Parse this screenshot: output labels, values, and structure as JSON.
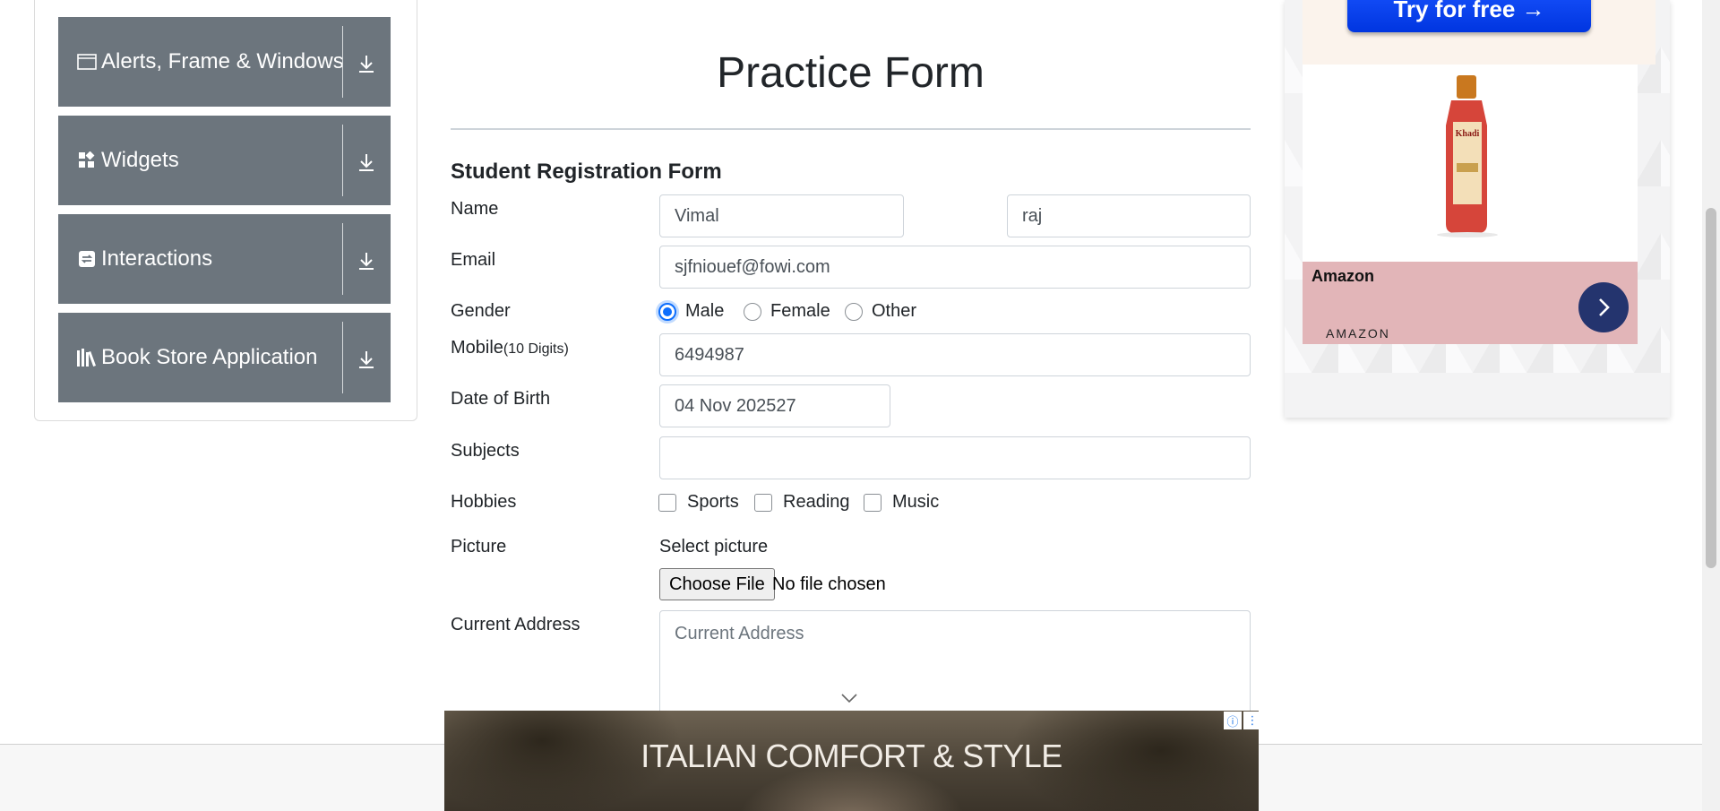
{
  "sidebar": {
    "groups": [
      {
        "label": "Alerts, Frame & Windows",
        "icon": "window-icon"
      },
      {
        "label": "Widgets",
        "icon": "widgets-icon"
      },
      {
        "label": "Interactions",
        "icon": "interactions-icon"
      },
      {
        "label": "Book Store Application",
        "icon": "books-icon"
      }
    ]
  },
  "form": {
    "title": "Practice Form",
    "heading": "Student Registration Form",
    "name_label": "Name",
    "first_name": "Vimal",
    "last_name": "raj",
    "email_label": "Email",
    "email": "sjfniouef@fowi.com",
    "gender_label": "Gender",
    "gender_options": [
      "Male",
      "Female",
      "Other"
    ],
    "gender_selected": "Male",
    "mobile_label": "Mobile",
    "mobile_hint": "(10 Digits)",
    "mobile": "6494987",
    "dob_label": "Date of Birth",
    "dob": "04 Nov 202527",
    "subjects_label": "Subjects",
    "subjects": "",
    "hobbies_label": "Hobbies",
    "hobbies": [
      "Sports",
      "Reading",
      "Music"
    ],
    "picture_label": "Picture",
    "select_picture": "Select picture",
    "choose_file": "Choose File",
    "file_status": "No file chosen",
    "address_label": "Current Address",
    "address_placeholder": "Current Address"
  },
  "ad_right": {
    "cta": "Try for free →",
    "advertiser": "Amazon",
    "brand": "AMAZON",
    "product_label": "Khadi"
  },
  "ad_bottom": {
    "headline": "ITALIAN COMFORT & STYLE"
  },
  "colors": {
    "sidebar_group_bg": "#6c757d",
    "radio_active": "#0d6efd",
    "ad_cta": "#0035e0",
    "amazon_strip": "#e2b5b8",
    "amazon_arrow": "#24346e"
  }
}
